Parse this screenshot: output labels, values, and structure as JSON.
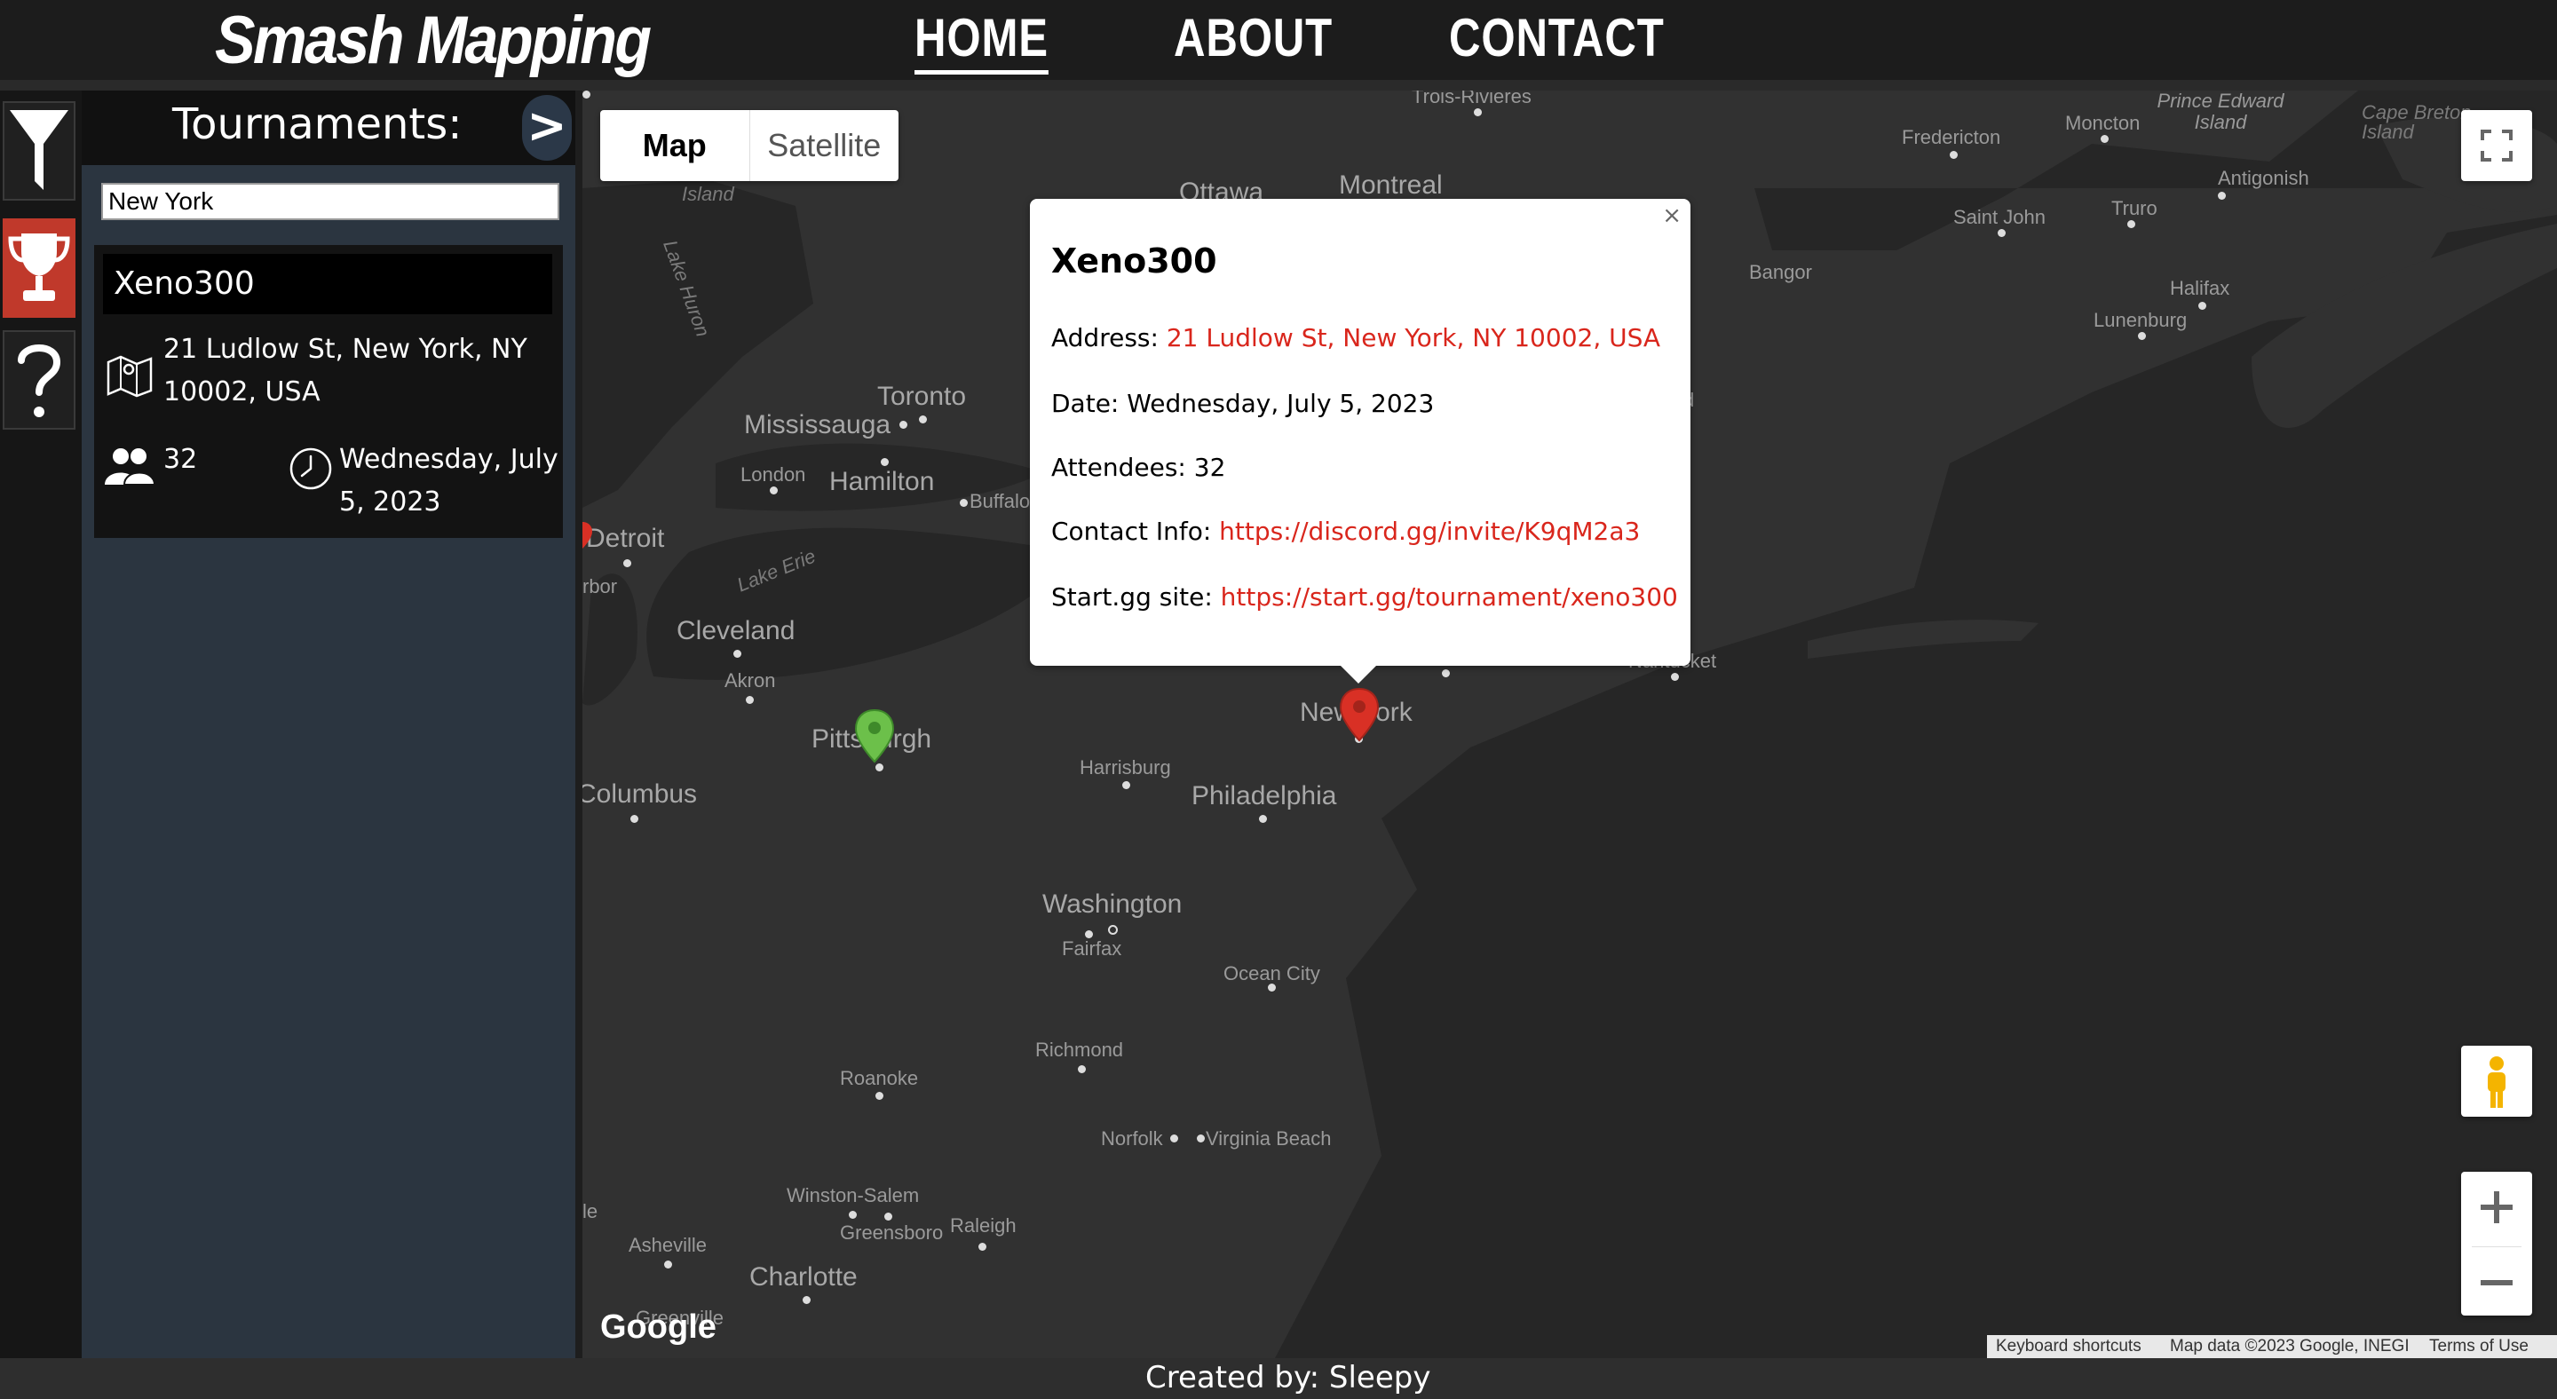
{
  "header": {
    "logo": "Smash Mapping",
    "nav": {
      "home": "HOME",
      "about": "ABOUT",
      "contact": "CONTACT"
    }
  },
  "panel": {
    "title": "Tournaments:",
    "toggle": ">",
    "search_value": "New York",
    "card": {
      "name": "Xeno300",
      "address": "21 Ludlow St, New York, NY 10002, USA",
      "attendees": "32",
      "date": "Wednesday, July 5, 2023"
    }
  },
  "map": {
    "type_map": "Map",
    "type_satellite": "Satellite",
    "google": "Google",
    "attribution": {
      "shortcuts": "Keyboard shortcuts",
      "data": "Map data ©2023 Google, INEGI",
      "terms": "Terms of Use"
    },
    "labels": {
      "trois_rivieres": "Trois-Rivieres",
      "ottawa": "Ottawa",
      "montreal": "Montreal",
      "island": "Island",
      "lake_huron": "Lake Huron",
      "toronto": "Toronto",
      "mississauga": "Mississauga",
      "london": "London",
      "hamilton": "Hamilton",
      "buffalo": "Buffalo",
      "detroit": "Detroit",
      "arbor": "rbor",
      "lake_erie": "Lake Erie",
      "cleveland": "Cleveland",
      "akron": "Akron",
      "pittsburgh": "Pittsburgh",
      "columbus": "Columbus",
      "harrisburg": "Harrisburg",
      "philadelphia": "Philadelphia",
      "new_york": "New York",
      "washington": "Washington",
      "fairfax": "Fairfax",
      "ocean_city": "Ocean City",
      "richmond": "Richmond",
      "roanoke": "Roanoke",
      "norfolk": "Norfolk",
      "virginia_beach": "Virginia Beach",
      "winston_salem": "Winston-Salem",
      "greensboro": "Greensboro",
      "raleigh": "Raleigh",
      "asheville": "Asheville",
      "charlotte": "Charlotte",
      "greenville": "Greenville",
      "le": "le",
      "fredericton": "Fredericton",
      "moncton": "Moncton",
      "pei": "Prince Edward Island",
      "cape_breton": "Cape Breton Island",
      "antigonish": "Antigonish",
      "saint_john": "Saint John",
      "truro": "Truro",
      "bangor": "Bangor",
      "halifax": "Halifax",
      "lunenburg": "Lunenburg",
      "nantucket": "Nantucket",
      "d": "d"
    }
  },
  "popup": {
    "title": "Xeno300",
    "close": "×",
    "address_label": "Address:",
    "address_value": "21 Ludlow St, New York, NY 10002, USA",
    "date_label": "Date:",
    "date_value": "Wednesday, July 5, 2023",
    "attendees_label": "Attendees:",
    "attendees_value": "32",
    "contact_label": "Contact Info:",
    "contact_value": "https://discord.gg/invite/K9qM2a3",
    "startgg_label": "Start.gg site:",
    "startgg_value": "https://start.gg/tournament/xeno300"
  },
  "footer": {
    "prefix": "Created by:",
    "author": "Sleepy"
  },
  "colors": {
    "accent": "#c0392b",
    "link": "#d9261c",
    "marker_red": "#d93025",
    "marker_green": "#6cc04a"
  },
  "icons": [
    "filter-icon",
    "trophy-icon",
    "help-icon",
    "map-icon",
    "people-icon",
    "clock-icon",
    "fullscreen-icon",
    "pegman-icon",
    "zoom-in-icon",
    "zoom-out-icon",
    "map-marker-icon"
  ]
}
